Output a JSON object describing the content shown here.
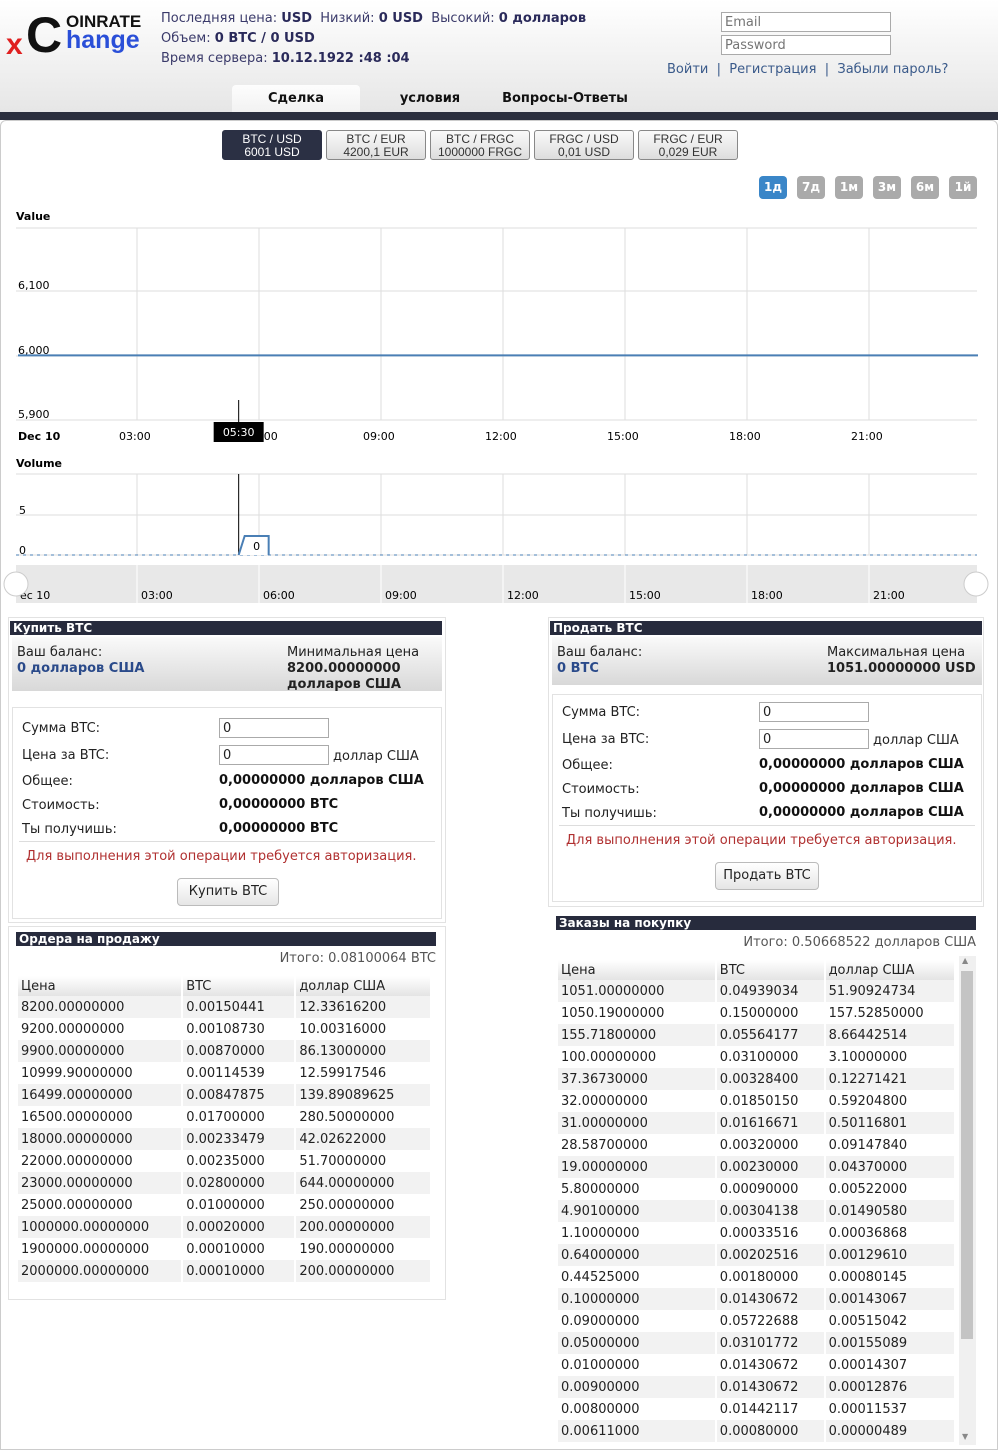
{
  "logo": {
    "top": "OINRATE",
    "x": "x",
    "C": "C",
    "bottom": "hange"
  },
  "stats": {
    "last_label": "Последняя цена:",
    "last_value": "USD",
    "low_label": "Низкий:",
    "low_value": "0 USD",
    "high_label": "Высокий:",
    "high_value": "0 долларов",
    "volume_label": "Объем:",
    "volume_value": "0 BTC / 0 USD",
    "time_label": "Время сервера:",
    "time_value": "10.12.1922 :48 :04"
  },
  "auth": {
    "email_placeholder": "Email",
    "password_placeholder": "Password",
    "login": "Войти",
    "register": "Регистрация",
    "forgot": "Забыли пароль?",
    "sep": "|"
  },
  "nav": {
    "tabs": [
      "Сделка",
      "условия",
      "Вопросы-Ответы"
    ]
  },
  "pairs": [
    {
      "name": "BTC / USD",
      "price": "6001 USD"
    },
    {
      "name": "BTC / EUR",
      "price": "4200,1 EUR"
    },
    {
      "name": "BTC / FRGC",
      "price": "1000000 FRGC"
    },
    {
      "name": "FRGC / USD",
      "price": "0,01 USD"
    },
    {
      "name": "FRGC / EUR",
      "price": "0,029 EUR"
    }
  ],
  "ranges": [
    "1д",
    "7д",
    "1м",
    "3м",
    "6м",
    "1й"
  ],
  "chart_data": {
    "type": "line",
    "price": {
      "title": "Value",
      "y_ticks": [
        "6,100",
        "6,000",
        "5,900"
      ],
      "ylim": [
        5900,
        6200
      ],
      "x": [
        0,
        24
      ],
      "values": [
        6001,
        6001
      ]
    },
    "volume": {
      "title": "Volume",
      "y_ticks": [
        "5",
        "0"
      ],
      "ylim": [
        0,
        10
      ],
      "bar": {
        "x": 5.5,
        "value": 0,
        "label": "0"
      }
    },
    "x_ticks": [
      "Dec 10",
      "03:00",
      "06:00",
      "09:00",
      "12:00",
      "15:00",
      "18:00",
      "21:00"
    ],
    "navigator_ticks": [
      "ec 10",
      "03:00",
      "06:00",
      "09:00",
      "12:00",
      "15:00",
      "18:00",
      "21:00"
    ],
    "tooltip": "05:30",
    "tooltip_hour": 5.5,
    "color": "#4a7fb5"
  },
  "buy": {
    "title": "Купить BTC",
    "balance_label": "Ваш баланс:",
    "balance_value": "0 долларов США",
    "min_label": "Минимальная цена",
    "min_value": "8200.00000000",
    "min_unit": "долларов США",
    "amount_label": "Сумма BTC:",
    "amount_value": "0",
    "price_label": "Цена за BTC:",
    "price_value": "0",
    "price_unit": "доллар США",
    "total_label": "Общее:",
    "total_value": "0,00000000 долларов США",
    "cost_label": "Стоимость:",
    "cost_value": "0,00000000 BTC",
    "receive_label": "Ты получишь:",
    "receive_value": "0,00000000 BTC",
    "warning": "Для выполнения этой операции требуется авторизация.",
    "button": "Купить BTC"
  },
  "sell": {
    "title": "Продать BTC",
    "balance_label": "Ваш баланс:",
    "balance_value": "0 BTC",
    "max_label": "Максимальная цена",
    "max_value": "1051.00000000 USD",
    "amount_label": "Сумма BTC:",
    "amount_value": "0",
    "price_label": "Цена за BTC:",
    "price_value": "0",
    "price_unit": "доллар США",
    "total_label": "Общее:",
    "total_value": "0,00000000 долларов США",
    "cost_label": "Стоимость:",
    "cost_value": "0,00000000 долларов США",
    "receive_label": "Ты получишь:",
    "receive_value": "0,00000000 долларов США",
    "warning": "Для выполнения этой операции требуется авторизация.",
    "button": "Продать BTC"
  },
  "sell_orders": {
    "title": "Ордера на продажу",
    "total": "Итого: 0.08100064 BTC",
    "columns": [
      "Цена",
      "BTC",
      "доллар США"
    ],
    "rows": [
      [
        "8200.00000000",
        "0.00150441",
        "12.33616200"
      ],
      [
        "9200.00000000",
        "0.00108730",
        "10.00316000"
      ],
      [
        "9900.00000000",
        "0.00870000",
        "86.13000000"
      ],
      [
        "10999.90000000",
        "0.00114539",
        "12.59917546"
      ],
      [
        "16499.00000000",
        "0.00847875",
        "139.89089625"
      ],
      [
        "16500.00000000",
        "0.01700000",
        "280.50000000"
      ],
      [
        "18000.00000000",
        "0.00233479",
        "42.02622000"
      ],
      [
        "22000.00000000",
        "0.00235000",
        "51.70000000"
      ],
      [
        "23000.00000000",
        "0.02800000",
        "644.00000000"
      ],
      [
        "25000.00000000",
        "0.01000000",
        "250.00000000"
      ],
      [
        "1000000.00000000",
        "0.00020000",
        "200.00000000"
      ],
      [
        "1900000.00000000",
        "0.00010000",
        "190.00000000"
      ],
      [
        "2000000.00000000",
        "0.00010000",
        "200.00000000"
      ]
    ]
  },
  "buy_orders": {
    "title": "Заказы на покупку",
    "total": "Итого: 0.50668522 долларов США",
    "columns": [
      "Цена",
      "BTC",
      "доллар США"
    ],
    "rows": [
      [
        "1051.00000000",
        "0.04939034",
        "51.90924734"
      ],
      [
        "1050.19000000",
        "0.15000000",
        "157.52850000"
      ],
      [
        "155.71800000",
        "0.05564177",
        "8.66442514"
      ],
      [
        "100.00000000",
        "0.03100000",
        "3.10000000"
      ],
      [
        "37.36730000",
        "0.00328400",
        "0.12271421"
      ],
      [
        "32.00000000",
        "0.01850150",
        "0.59204800"
      ],
      [
        "31.00000000",
        "0.01616671",
        "0.50116801"
      ],
      [
        "28.58700000",
        "0.00320000",
        "0.09147840"
      ],
      [
        "19.00000000",
        "0.00230000",
        "0.04370000"
      ],
      [
        "5.80000000",
        "0.00090000",
        "0.00522000"
      ],
      [
        "4.90100000",
        "0.00304138",
        "0.01490580"
      ],
      [
        "1.10000000",
        "0.00033516",
        "0.00036868"
      ],
      [
        "0.64000000",
        "0.00202516",
        "0.00129610"
      ],
      [
        "0.44525000",
        "0.00180000",
        "0.00080145"
      ],
      [
        "0.10000000",
        "0.01430672",
        "0.00143067"
      ],
      [
        "0.09000000",
        "0.05722688",
        "0.00515042"
      ],
      [
        "0.05000000",
        "0.03101772",
        "0.00155089"
      ],
      [
        "0.01000000",
        "0.01430672",
        "0.00014307"
      ],
      [
        "0.00900000",
        "0.01430672",
        "0.00012876"
      ],
      [
        "0.00800000",
        "0.01442117",
        "0.00011537"
      ],
      [
        "0.00611000",
        "0.00080000",
        "0.00000489"
      ]
    ]
  }
}
